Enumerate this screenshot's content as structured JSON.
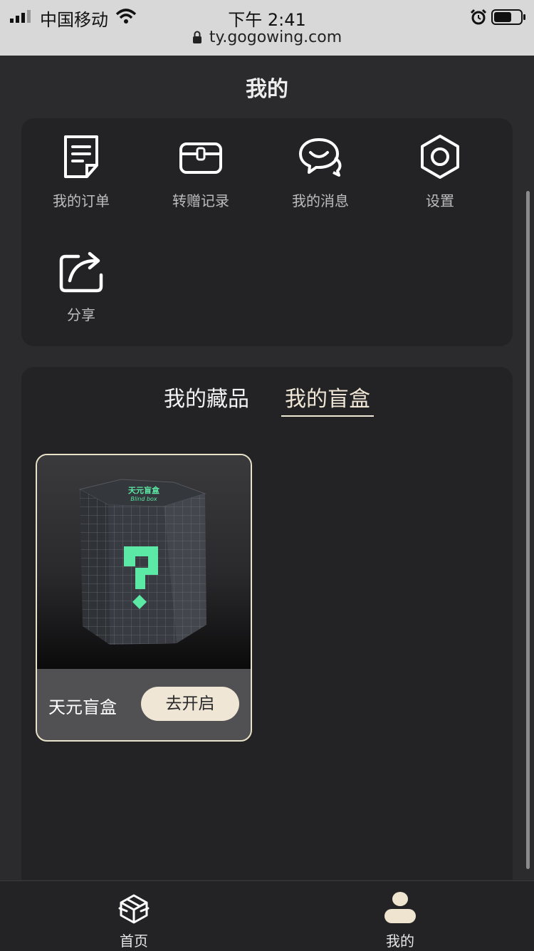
{
  "status_bar": {
    "carrier": "中国移动",
    "time": "下午 2:41",
    "url": "ty.gogowing.com"
  },
  "page": {
    "title": "我的"
  },
  "menu": {
    "items": [
      {
        "label": "我的订单",
        "icon": "order-document-icon"
      },
      {
        "label": "转赠记录",
        "icon": "gift-box-icon"
      },
      {
        "label": "我的消息",
        "icon": "message-bubble-icon"
      },
      {
        "label": "设置",
        "icon": "settings-hexagon-icon"
      },
      {
        "label": "分享",
        "icon": "share-icon"
      }
    ]
  },
  "collection": {
    "tabs": [
      {
        "label": "我的藏品",
        "active": false
      },
      {
        "label": "我的盲盒",
        "active": true
      }
    ],
    "items": [
      {
        "name": "天元盲盒",
        "button_label": "去开启",
        "box_title": "天元盲盒",
        "box_subtitle": "Blind box"
      }
    ]
  },
  "bottom_nav": {
    "items": [
      {
        "label": "首页",
        "icon": "home-box-icon"
      },
      {
        "label": "我的",
        "icon": "user-icon"
      }
    ]
  },
  "colors": {
    "background": "#2b2b2d",
    "card": "#232325",
    "accent": "#f0e6d6",
    "text": "#ededed"
  }
}
